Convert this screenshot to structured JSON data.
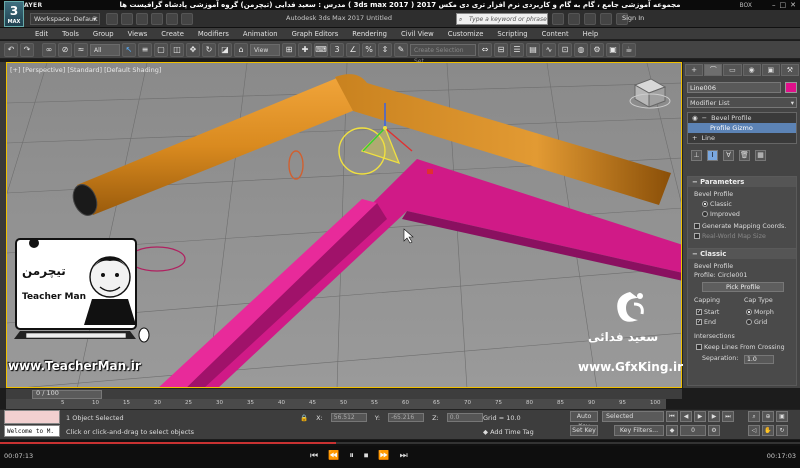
{
  "player": {
    "name": "KMPLAYER",
    "window_title": "مجموعه آموزشی جامع ، گام به گام و کاربردی نرم افزار تری دی مکس 2017 ( 3ds max 2017 ) مدرس : سعید فدایی (تیچرمن) گروه آموزشی پادشاه گرافیست ها",
    "box_label": "BOX",
    "time_current": "00:07:13",
    "time_total": "00:17:03",
    "progress": 0.42
  },
  "app": {
    "logo_num": "3",
    "logo_text": "MAX",
    "workspace_label": "Workspace: Default",
    "title": "Autodesk 3ds Max 2017     Untitled",
    "search_placeholder": "Type a keyword or phrase",
    "sign_in": "Sign In"
  },
  "menu": [
    "Edit",
    "Tools",
    "Group",
    "Views",
    "Create",
    "Modifiers",
    "Animation",
    "Graph Editors",
    "Rendering",
    "Civil View",
    "Customize",
    "Scripting",
    "Content",
    "Help"
  ],
  "toolbar": {
    "filter": "All",
    "ref_coord": "View",
    "create_selection": "Create Selection Set"
  },
  "viewport": {
    "label": "[+] [Perspective] [Standard] [Default Shading]"
  },
  "command_panel": {
    "tabs": [
      "+",
      "⌒",
      "▭",
      "◉",
      "▣",
      "⚒"
    ],
    "object_name": "Line006",
    "object_color": "#e0108a",
    "modifier_list": "Modifier List",
    "stack": [
      {
        "label": "Bevel Profile",
        "selected": false
      },
      {
        "label": "Profile Gizmo",
        "selected": true
      },
      {
        "label": "Line",
        "selected": false
      }
    ],
    "parameters": {
      "title": "Parameters",
      "group": "Bevel Profile",
      "classic": "Classic",
      "improved": "Improved",
      "gen_mapping": "Generate Mapping Coords.",
      "real_world": "Real-World Map Size"
    },
    "classic": {
      "title": "Classic",
      "group": "Bevel Profile",
      "profile": "Profile: Circle001",
      "pick_button": "Pick Profile",
      "capping": "Capping",
      "cap_type": "Cap Type",
      "start": "Start",
      "end": "End",
      "morph": "Morph",
      "grid": "Grid",
      "intersections": "Intersections",
      "keep_lines": "Keep Lines From Crossing",
      "separation_label": "Separation:",
      "separation_value": "1.0"
    }
  },
  "timeline": {
    "frame_display": "0 / 100",
    "ticks": [
      "5",
      "10",
      "15",
      "20",
      "25",
      "30",
      "35",
      "40",
      "45",
      "50",
      "55",
      "60",
      "65",
      "70",
      "75",
      "80",
      "85",
      "90",
      "95",
      "100"
    ]
  },
  "status": {
    "maxscript": "Welcome to M.",
    "line1": "1 Object Selected",
    "line2": "Click or click-and-drag to select objects",
    "x_label": "X:",
    "x_value": "56.512",
    "y_label": "Y:",
    "y_value": "-65.216",
    "z_label": "Z:",
    "z_value": "0.0",
    "grid": "Grid = 10.0",
    "time_tag": "Add Time Tag",
    "auto_key": "Auto Key",
    "set_key": "Set Key",
    "selected": "Selected",
    "key_filters": "Key Filters..."
  },
  "overlay": {
    "teacherman_title": "Teacher Man",
    "teacherman_fa": "تیچرمن",
    "teacherman_url": "www.TeacherMan.ir",
    "gfx_name": "سعید فدائی",
    "gfx_url": "www.GfxKing.ir"
  }
}
